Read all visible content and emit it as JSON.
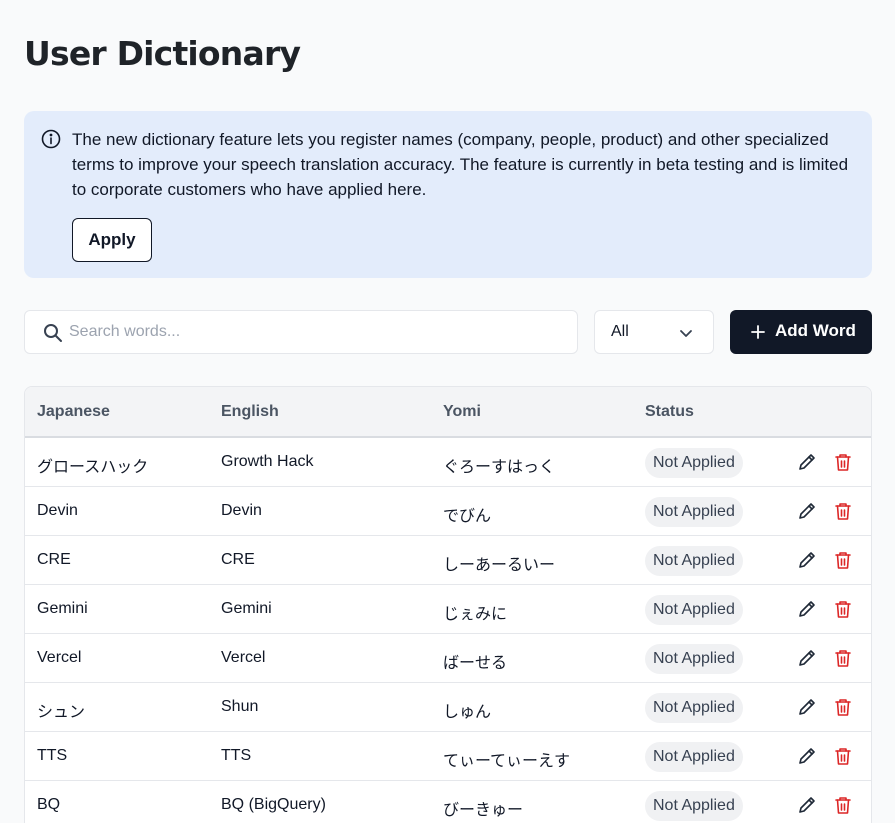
{
  "page": {
    "title": "User Dictionary"
  },
  "banner": {
    "icon": "info-icon",
    "text": "The new dictionary feature lets you register names (company, people, product) and other specialized terms to improve your speech translation accuracy. The feature is currently in beta testing and is limited to corporate customers who have applied here.",
    "apply_label": "Apply",
    "background_color": "#e3ecfb"
  },
  "toolbar": {
    "search_placeholder": "Search words...",
    "search_value": "",
    "filter_value": "All",
    "add_word_label": "Add Word",
    "add_word_color": "#111827"
  },
  "table": {
    "headers": [
      "Japanese",
      "English",
      "Yomi",
      "Status"
    ],
    "rows": [
      {
        "japanese": "グロースハック",
        "english": "Growth Hack",
        "yomi": "ぐろーすはっく",
        "status": "Not Applied"
      },
      {
        "japanese": "Devin",
        "english": "Devin",
        "yomi": "でびん",
        "status": "Not Applied"
      },
      {
        "japanese": "CRE",
        "english": "CRE",
        "yomi": "しーあーるいー",
        "status": "Not Applied"
      },
      {
        "japanese": "Gemini",
        "english": "Gemini",
        "yomi": "じぇみに",
        "status": "Not Applied"
      },
      {
        "japanese": "Vercel",
        "english": "Vercel",
        "yomi": "ばーせる",
        "status": "Not Applied"
      },
      {
        "japanese": "シュン",
        "english": "Shun",
        "yomi": "しゅん",
        "status": "Not Applied"
      },
      {
        "japanese": "TTS",
        "english": "TTS",
        "yomi": "てぃーてぃーえす",
        "status": "Not Applied"
      },
      {
        "japanese": "BQ",
        "english": "BQ (BigQuery)",
        "yomi": "びーきゅー",
        "status": "Not Applied"
      }
    ],
    "row_icons": {
      "edit": "pencil-icon",
      "delete": "trash-icon"
    },
    "delete_color": "#dc2626"
  }
}
